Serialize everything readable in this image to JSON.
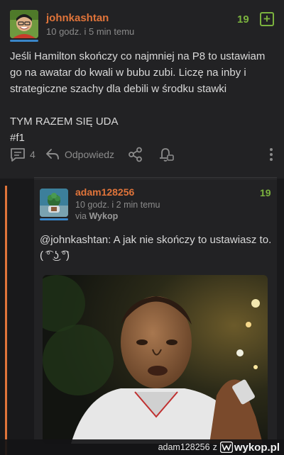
{
  "post": {
    "author": "johnkashtan",
    "time": "10 godz. i 5 min temu",
    "votes": "19",
    "plus_icon": "plus-square-icon",
    "body": "Jeśli Hamilton skończy co najmniej na P8 to ustawiam go na awatar do kwali w bubu zubi. Liczę na inby i strategiczne szachy dla debili w środku stawki\n\nTYM RAZEM SIĘ UDA\n#f1",
    "comments_count": "4",
    "reply_label": "Odpowiedz"
  },
  "reply": {
    "author": "adam128256",
    "time": "10 godz. i 2 min temu",
    "via_prefix": "via",
    "via_app": "Wykop",
    "votes": "19",
    "text": "@johnkashtan: A jak nie skończy to ustawiasz to. ( ͡° ͜ʖ ͡°)"
  },
  "footer": {
    "user": "adam128256",
    "z": "z",
    "site": "wykop.pl"
  },
  "colors": {
    "accent_orange": "#e0743a",
    "vote_green": "#7bb23e",
    "background": "#19191b"
  }
}
